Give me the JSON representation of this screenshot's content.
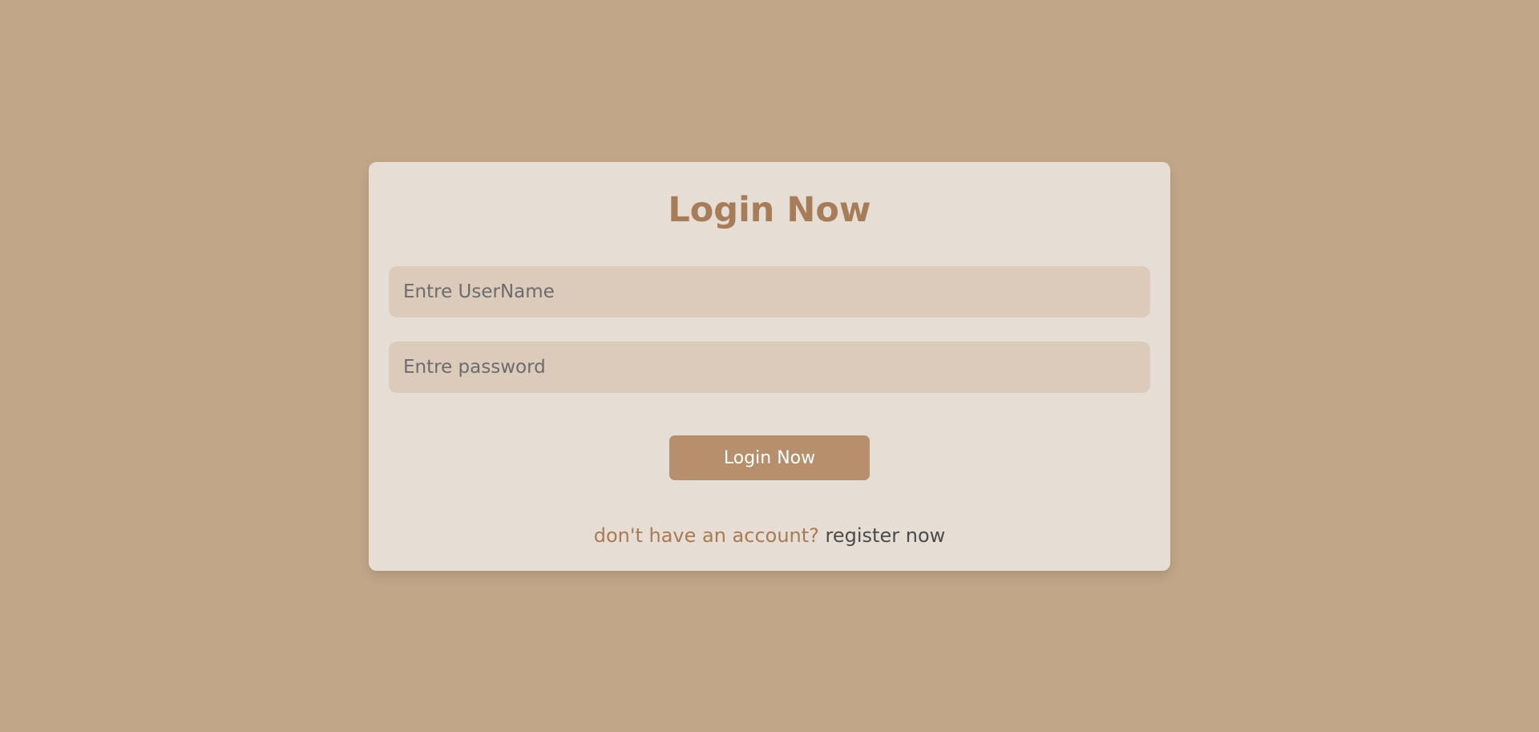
{
  "login": {
    "title": "Login Now",
    "username_placeholder": "Entre UserName",
    "password_placeholder": "Entre password",
    "submit_label": "Login Now",
    "register_prompt": "don't have an account?",
    "register_link": "register now"
  },
  "colors": {
    "page_background": "#c1a788",
    "card_background": "#e6ddd4",
    "input_background": "#dccbbb",
    "accent": "#a77c58",
    "button": "#b68f6c"
  }
}
